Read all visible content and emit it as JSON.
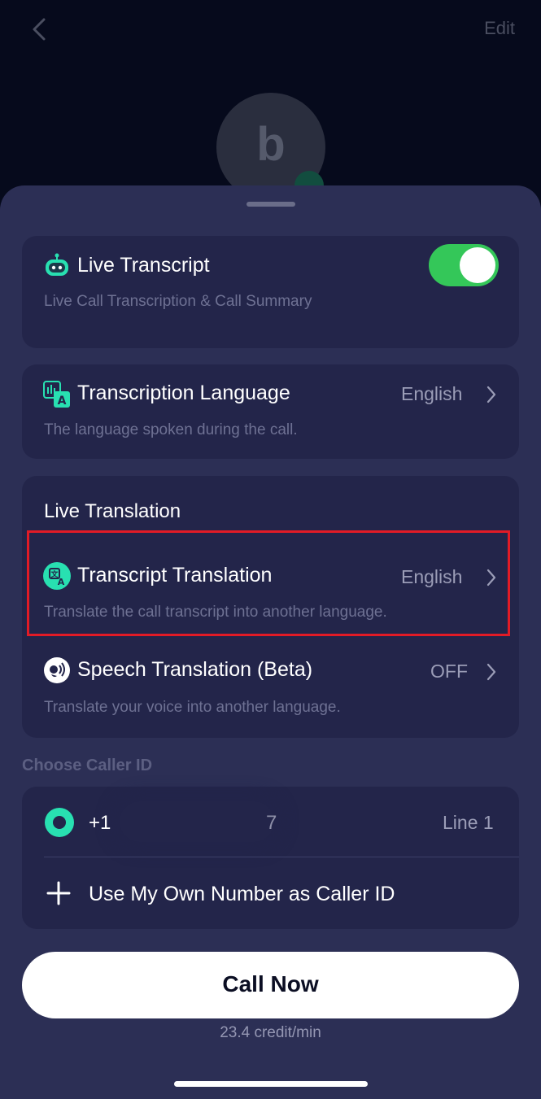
{
  "header": {
    "edit_label": "Edit"
  },
  "contact": {
    "avatar_letter": "b"
  },
  "live_transcript": {
    "title": "Live Transcript",
    "subtitle": "Live Call Transcription & Call Summary",
    "enabled": true
  },
  "transcription_language": {
    "title": "Transcription Language",
    "value": "English",
    "subtitle": "The language spoken during the call."
  },
  "live_translation": {
    "heading": "Live Translation",
    "transcript_translation": {
      "title": "Transcript Translation",
      "value": "English",
      "subtitle": "Translate the call transcript into another language."
    },
    "speech_translation": {
      "title": "Speech Translation (Beta)",
      "value": "OFF",
      "subtitle": "Translate your voice into another language."
    }
  },
  "caller_id": {
    "heading": "Choose Caller ID",
    "number_prefix": "+1",
    "number_suffix": "7",
    "line_label": "Line 1",
    "own_number_label": "Use My Own Number as Caller ID"
  },
  "footer": {
    "call_button": "Call Now",
    "rate": "23.4 credit/min"
  },
  "colors": {
    "sheet_bg": "#2c2f55",
    "card_bg": "#23254a",
    "toggle_on": "#34c759",
    "accent_teal": "#28e0b1",
    "highlight_red": "#e21b26"
  },
  "icons": [
    "chevron-left-icon",
    "robot-icon",
    "language-icon",
    "translate-icon",
    "speech-icon",
    "chevron-right-icon",
    "radio-selected-icon",
    "plus-icon"
  ]
}
